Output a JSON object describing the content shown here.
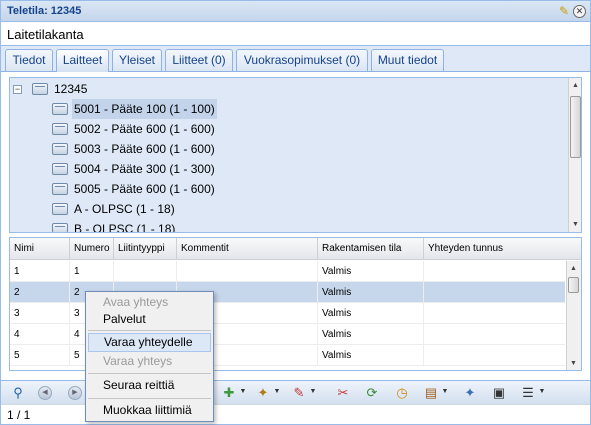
{
  "window": {
    "title": "Teletila: 12345",
    "subtitle": "Laitetilakanta"
  },
  "tabs": [
    {
      "label": "Tiedot"
    },
    {
      "label": "Laitteet"
    },
    {
      "label": "Yleiset"
    },
    {
      "label": "Liitteet (0)"
    },
    {
      "label": "Vuokrasopimukset (0)"
    },
    {
      "label": "Muut tiedot"
    }
  ],
  "tree": {
    "root_label": "12345",
    "collapse_symbol": "−",
    "children": [
      {
        "label": "5001 - Pääte 100 (1 - 100)"
      },
      {
        "label": "5002 - Pääte 600 (1 - 600)"
      },
      {
        "label": "5003 - Pääte 600 (1 - 600)"
      },
      {
        "label": "5004 - Pääte 300 (1 - 300)"
      },
      {
        "label": "5005 - Pääte 600 (1 - 600)"
      },
      {
        "label": "A - OLPSC (1 - 18)"
      },
      {
        "label": "B - OLPSC (1 - 18)"
      }
    ]
  },
  "grid": {
    "columns": [
      "Nimi",
      "Numero",
      "Liitintyyppi",
      "Kommentit",
      "Rakentamisen tila",
      "Yhteyden tunnus"
    ],
    "rows": [
      [
        "1",
        "1",
        "",
        "",
        "Valmis",
        ""
      ],
      [
        "2",
        "2",
        "",
        "",
        "Valmis",
        ""
      ],
      [
        "3",
        "3",
        "",
        "",
        "Valmis",
        ""
      ],
      [
        "4",
        "4",
        "",
        "",
        "Valmis",
        ""
      ],
      [
        "5",
        "5",
        "",
        "",
        "Valmis",
        ""
      ]
    ]
  },
  "context_menu": {
    "items": [
      {
        "label": "Avaa yhteys",
        "state": "disabled"
      },
      {
        "label": "Palvelut",
        "state": "enabled"
      },
      {
        "label": "Varaa yhteydelle",
        "state": "active"
      },
      {
        "label": "Varaa yhteys",
        "state": "disabled"
      },
      {
        "label": "Seuraa reittiä",
        "state": "enabled"
      },
      {
        "label": "Muokkaa liittimiä",
        "state": "enabled"
      }
    ]
  },
  "toolbar": {
    "icons": [
      "search-icon",
      "prev-icon",
      "next-icon",
      "expand-icon",
      "wand-icon",
      "pencil-icon",
      "scissors-icon",
      "refresh-icon",
      "clock-icon",
      "document-icon",
      "satellite-icon",
      "network-icon",
      "menu-icon"
    ]
  },
  "status": {
    "paging": "1 / 1"
  },
  "colors": {
    "panel_background": "#dfe8f6",
    "border": "#99bbe8",
    "selection": "#c6d6eb",
    "title_text": "#15428b"
  }
}
